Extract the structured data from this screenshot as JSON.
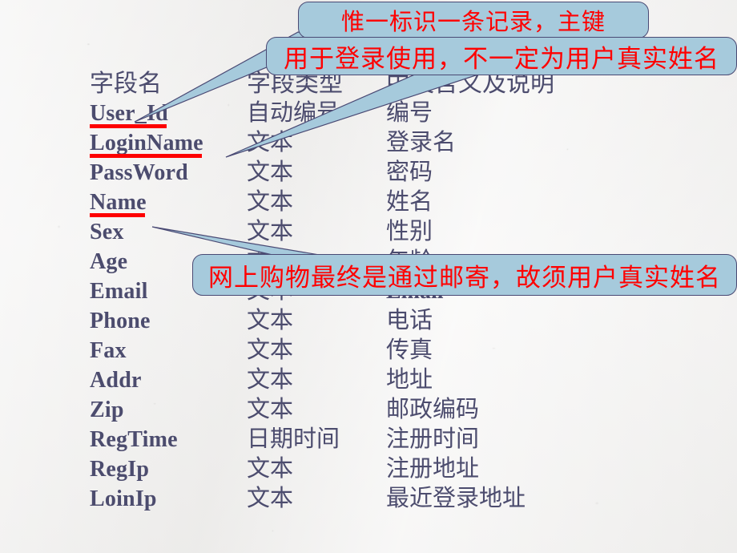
{
  "slide": {
    "background_color": "#f1f0ef",
    "text_color": "#4c4c6e",
    "callout_fill": "#a6cadc",
    "callout_border": "#4a4a74",
    "callout_text_color": "#ff0000",
    "underline_color": "#fe0000"
  },
  "table": {
    "header": {
      "name": "字段名",
      "type": "字段类型",
      "desc": "中文含义及说明"
    },
    "rows": [
      {
        "name": "User_Id",
        "type": "自动编号",
        "desc": "编号",
        "underlined": true,
        "desc_latin": false
      },
      {
        "name": "LoginName",
        "type": "文本",
        "desc": "登录名",
        "underlined": true,
        "desc_latin": false
      },
      {
        "name": "PassWord",
        "type": "文本",
        "desc": "密码",
        "underlined": false,
        "desc_latin": false
      },
      {
        "name": "Name",
        "type": "文本",
        "desc": "姓名",
        "underlined": true,
        "desc_latin": false
      },
      {
        "name": "Sex",
        "type": "文本",
        "desc": "性别",
        "underlined": false,
        "desc_latin": false
      },
      {
        "name": "Age",
        "type": "文本",
        "desc": "年龄",
        "underlined": false,
        "desc_latin": false
      },
      {
        "name": "Email",
        "type": "文本",
        "desc": "Email",
        "underlined": false,
        "desc_latin": true
      },
      {
        "name": "Phone",
        "type": "文本",
        "desc": "电话",
        "underlined": false,
        "desc_latin": false
      },
      {
        "name": "Fax",
        "type": "文本",
        "desc": "传真",
        "underlined": false,
        "desc_latin": false
      },
      {
        "name": "Addr",
        "type": "文本",
        "desc": "地址",
        "underlined": false,
        "desc_latin": false
      },
      {
        "name": "Zip",
        "type": "文本",
        "desc": "邮政编码",
        "underlined": false,
        "desc_latin": false
      },
      {
        "name": "RegTime",
        "type": "日期时间",
        "desc": "注册时间",
        "underlined": false,
        "desc_latin": false
      },
      {
        "name": "RegIp",
        "type": "文本",
        "desc": "注册地址",
        "underlined": false,
        "desc_latin": false
      },
      {
        "name": "LoinIp",
        "type": "文本",
        "desc": "最近登录地址",
        "underlined": false,
        "desc_latin": false
      }
    ]
  },
  "callouts": {
    "primary_key": "惟一标识一条记录，主键",
    "login_name": "用于登录使用，不一定为用户真实姓名",
    "real_name": "网上购物最终是通过邮寄，故须用户真实姓名"
  }
}
